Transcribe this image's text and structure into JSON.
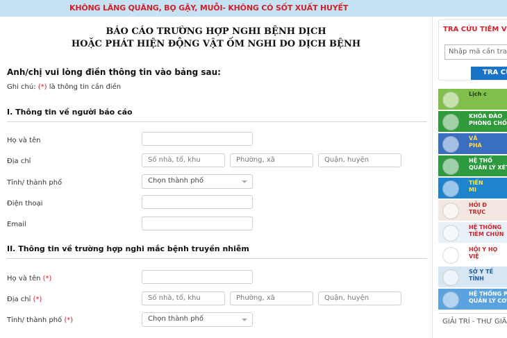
{
  "top_banner": {
    "marquee": "KHÔNG LĂNG QUĂNG, BỌ GẬY, MUỖI- KHÔNG CÓ SỐT XUẤT HUYẾT"
  },
  "form": {
    "title_line1": "BÁO CÁO TRƯỜNG HỢP NGHI BỆNH DỊCH",
    "title_line2": "HOẶC PHÁT HIỆN ĐỘNG VẬT ỐM NGHI DO DỊCH BỆNH",
    "lead": "Anh/chị vui lòng điền thông tin vào bảng sau:",
    "note_prefix": "Ghi chú: ",
    "note_mark": "(*)",
    "note_suffix": " là thông tin cần điền",
    "section1": {
      "heading": "I. Thông tin về người báo cáo",
      "name_label": "Họ và tên",
      "address_label": "Địa chỉ",
      "address_placeholders": [
        "Số nhà, tổ, khu",
        "Phường, xã",
        "Quận, huyện"
      ],
      "city_label": "Tỉnh/ thành phố",
      "city_select": "Chọn thành phố",
      "phone_label": "Điện thoại",
      "email_label": "Email"
    },
    "section2": {
      "heading": "II. Thông tin về trường hợp nghi mắc bệnh truyền nhiễm",
      "name_label": "Họ và tên ",
      "address_label": "Địa chỉ ",
      "address_placeholders": [
        "Số nhà, tổ, khu",
        "Phường, xã",
        "Quận, huyện"
      ],
      "city_label": "Tỉnh/ thành phố ",
      "city_select": "Chọn thành phố",
      "required_mark": "(*)"
    }
  },
  "sidebar": {
    "lookup_title": "TRA CỨU TIÊM VẮC",
    "lookup_placeholder": "Nhập mã cần tra",
    "lookup_button": "TRA CỨU",
    "banners": [
      {
        "text": "Lịch c",
        "bg": "#7fbf4a",
        "fg": "#1b3a0f"
      },
      {
        "text": "KHÓA ĐÀO\nPHÒNG CHỐNG VI",
        "bg": "#2f9a3a",
        "fg": "#ffffff"
      },
      {
        "text": "VĂ\nPHÁ",
        "bg": "#3a6fc0",
        "fg": "#ffd84a"
      },
      {
        "text": "HỆ THỐ\nQUẢN LÝ XÉT N",
        "bg": "#2c9a3e",
        "fg": "#ffffff"
      },
      {
        "text": "TIẾN\nMI",
        "bg": "#1f84d0",
        "fg": "#ffe44a"
      },
      {
        "text": "HỎI Đ\nTRỰC",
        "bg": "#f3e7e2",
        "fg": "#c12a2a"
      },
      {
        "text": "HỆ THỐNG\nTIÊM CHỦN",
        "bg": "#e8f1f7",
        "fg": "#d0222a"
      },
      {
        "text": "HỘI Y HỌ\nVIỆ",
        "bg": "#ffffff",
        "fg": "#c12a2a"
      },
      {
        "text": "SỞ Y TẾ\nTỈNH",
        "bg": "#d7e6f3",
        "fg": "#1a5ca8"
      },
      {
        "text": "HỆ THỐNG PHẦN\nQUẢN LÝ CƠ SỞ DỮ LIỆU",
        "bg": "#5aa3df",
        "fg": "#ffffff"
      }
    ],
    "entertainment": "GIẢI TRÍ - THƯ GIÃN"
  }
}
